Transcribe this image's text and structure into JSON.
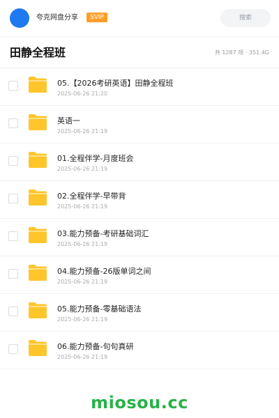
{
  "header": {
    "username": "夸克网盘分享",
    "badge": "SVIP",
    "search_label": "搜索"
  },
  "folder": {
    "title": "田静全程班",
    "summary": "共 1287 项 · 351.4G"
  },
  "items": [
    {
      "name": "05.【2026考研英语】田静全程班",
      "date": "2025-06-26 21:20"
    },
    {
      "name": "英语一",
      "date": "2025-06-26 21:19"
    },
    {
      "name": "01.全程伴学-月度班会",
      "date": "2025-06-26 21:19"
    },
    {
      "name": "02.全程伴学-早带背",
      "date": "2025-06-26 21:19"
    },
    {
      "name": "03.能力预备-考研基础词汇",
      "date": "2025-06-26 21:19"
    },
    {
      "name": "04.能力预备-26版单词之间",
      "date": "2025-06-26 21:19"
    },
    {
      "name": "05.能力预备-零基础语法",
      "date": "2025-06-26 21:19"
    },
    {
      "name": "06.能力预备-句句真研",
      "date": "2025-06-26 21:19"
    }
  ],
  "watermark": "miosou.cc",
  "colors": {
    "accent": "#1f7af0",
    "badge": "#ff9e2b",
    "folder": "#ffc62b",
    "brand": "#29b24a"
  }
}
